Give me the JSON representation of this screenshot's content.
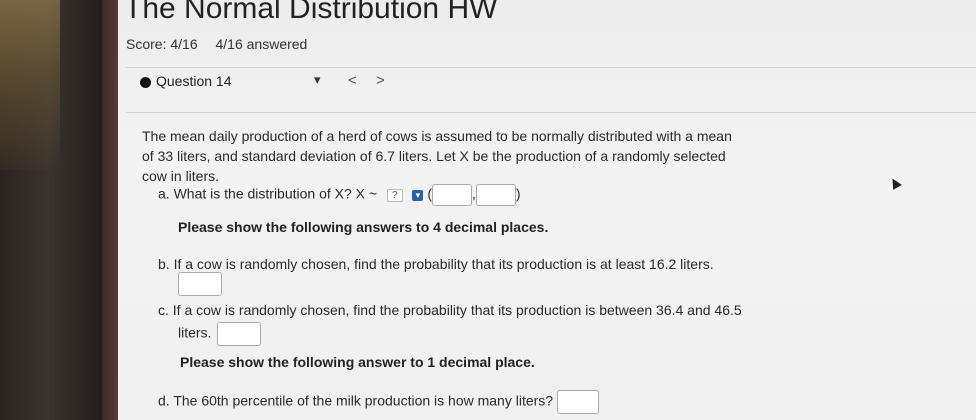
{
  "header": {
    "title": "The Normal Distribution HW",
    "score": "Score: 4/16",
    "answered": "4/16 answered"
  },
  "question_nav": {
    "label": "Question 14",
    "dropdown_icon": "caret-down-icon",
    "prev": "<",
    "next": ">"
  },
  "question": {
    "text": "The mean daily production of a herd of cows is assumed to be normally distributed with a mean of 33 liters, and standard deviation of 6.7 liters. Let X be the production of a randomly selected cow in liters.",
    "a": {
      "label": "a.",
      "text": "What is the distribution of X? X ~",
      "select_value": "?",
      "open_paren": "(",
      "comma": ",",
      "close_paren": ")"
    },
    "note1": "Please show the following answers to 4 decimal places.",
    "b": {
      "label": "b.",
      "text": "If a cow is randomly chosen, find the probability that its production is at least 16.2 liters."
    },
    "c": {
      "label": "c.",
      "text": "If a cow is randomly chosen, find the probability that its production is between 36.4 and 46.5",
      "text2": "liters."
    },
    "note2": "Please show the following answer to 1 decimal place.",
    "d": {
      "label": "d.",
      "text": "The 60th percentile of the milk production is how many liters?"
    }
  }
}
